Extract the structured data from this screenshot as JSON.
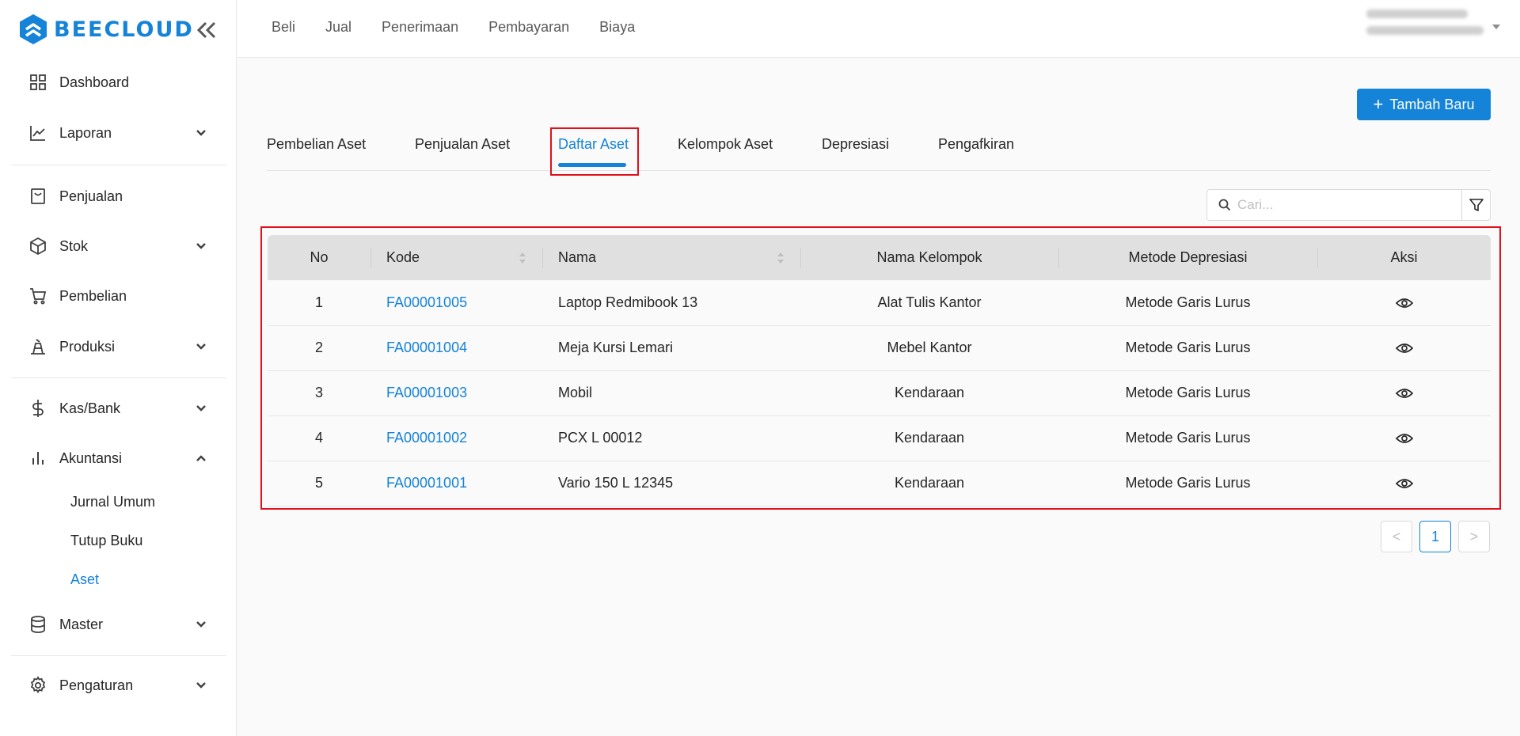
{
  "brand": {
    "name": "BEECLOUD"
  },
  "sidebar": {
    "items": [
      {
        "label": "Dashboard",
        "icon": "dashboard-icon"
      },
      {
        "label": "Laporan",
        "icon": "line-chart-icon"
      },
      {
        "label": "Penjualan",
        "icon": "shopping-bag-icon"
      },
      {
        "label": "Stok",
        "icon": "cube-icon"
      },
      {
        "label": "Pembelian",
        "icon": "cart-icon"
      },
      {
        "label": "Produksi",
        "icon": "factory-icon"
      },
      {
        "label": "Kas/Bank",
        "icon": "dollar-icon"
      },
      {
        "label": "Akuntansi",
        "icon": "bar-chart-icon"
      },
      {
        "label": "Master",
        "icon": "database-icon"
      },
      {
        "label": "Pengaturan",
        "icon": "gear-icon"
      }
    ],
    "akuntansi_sub": [
      "Jurnal Umum",
      "Tutup Buku",
      "Aset"
    ]
  },
  "topnav": [
    "Beli",
    "Jual",
    "Penerimaan",
    "Pembayaran",
    "Biaya"
  ],
  "actions": {
    "add_label": "Tambah Baru"
  },
  "tabs": [
    "Pembelian Aset",
    "Penjualan Aset",
    "Daftar Aset",
    "Kelompok Aset",
    "Depresiasi",
    "Pengafkiran"
  ],
  "search": {
    "placeholder": "Cari..."
  },
  "table": {
    "headers": [
      "No",
      "Kode",
      "Nama",
      "Nama Kelompok",
      "Metode Depresiasi",
      "Aksi"
    ],
    "rows": [
      {
        "no": "1",
        "kode": "FA00001005",
        "nama": "Laptop Redmibook 13",
        "kelompok": "Alat Tulis Kantor",
        "metode": "Metode Garis Lurus"
      },
      {
        "no": "2",
        "kode": "FA00001004",
        "nama": "Meja Kursi Lemari",
        "kelompok": "Mebel Kantor",
        "metode": "Metode Garis Lurus"
      },
      {
        "no": "3",
        "kode": "FA00001003",
        "nama": "Mobil",
        "kelompok": "Kendaraan",
        "metode": "Metode Garis Lurus"
      },
      {
        "no": "4",
        "kode": "FA00001002",
        "nama": "PCX L 00012",
        "kelompok": "Kendaraan",
        "metode": "Metode Garis Lurus"
      },
      {
        "no": "5",
        "kode": "FA00001001",
        "nama": "Vario 150 L 12345",
        "kelompok": "Kendaraan",
        "metode": "Metode Garis Lurus"
      }
    ]
  },
  "pagination": {
    "current": "1",
    "prev": "<",
    "next": ">"
  },
  "colors": {
    "accent": "#1483d8",
    "highlight": "#e0101a",
    "header_bg": "#e0e0e0"
  }
}
